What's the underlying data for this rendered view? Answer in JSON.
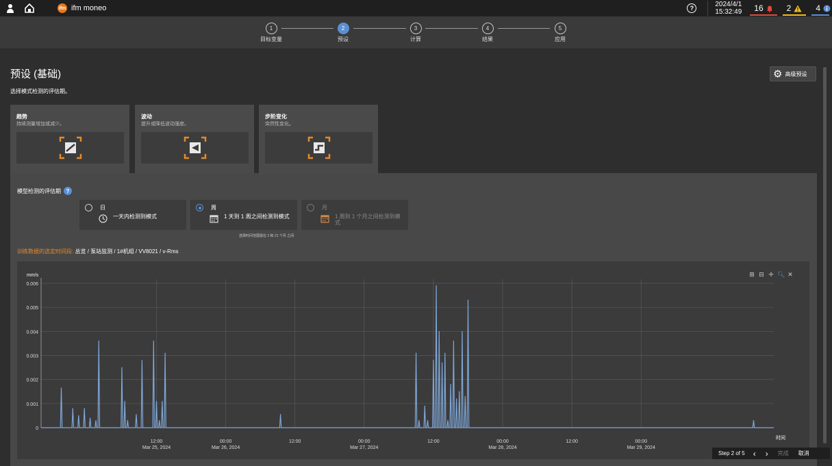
{
  "topbar": {
    "app_title": "ifm moneo",
    "date": "2024/4/1",
    "time": "15:32:49",
    "alarms": [
      {
        "count": "16",
        "icon": "bell-icon",
        "color": "#e04a3a"
      },
      {
        "count": "2",
        "icon": "warning-icon",
        "color": "#f0c020"
      },
      {
        "count": "4",
        "icon": "info-icon",
        "color": "#5b8fd4"
      }
    ]
  },
  "wizard": {
    "steps": [
      {
        "num": "1",
        "label": "目标变量"
      },
      {
        "num": "2",
        "label": "预设"
      },
      {
        "num": "3",
        "label": "计算"
      },
      {
        "num": "4",
        "label": "结果"
      },
      {
        "num": "5",
        "label": "应用"
      }
    ],
    "active_step": 2
  },
  "page": {
    "title": "预设 (基础)",
    "subtitle": "选择模式检测的评估期。",
    "advanced_button": "高级预设"
  },
  "cards": [
    {
      "title": "趋势",
      "desc": "持续测量增加或减少。",
      "icon": "trend-icon"
    },
    {
      "title": "波动",
      "desc": "提升或降低波动强度。",
      "icon": "fluctuation-icon"
    },
    {
      "title": "步阶变化",
      "desc": "突然性变化。",
      "icon": "step-change-icon"
    }
  ],
  "period": {
    "label": "模型检测的评估期",
    "options": [
      {
        "name": "日",
        "desc": "一天内检测到模式",
        "icon": "clock-icon",
        "selected": false,
        "enabled": true
      },
      {
        "name": "周",
        "desc": "1 天到 1 周之间检测到模式",
        "icon": "calendar-icon",
        "selected": true,
        "enabled": true
      },
      {
        "name": "月",
        "desc": "1 周到 1 个月之间检测到模式",
        "icon": "calendar-icon",
        "selected": false,
        "enabled": false
      }
    ],
    "note": "选择时间范围需在 2 和 21 个月 之间"
  },
  "training": {
    "prefix": "训练数据的选定时间段:",
    "path": "总览 / 泵站监测 / 1#机组 / VV8021 / v-Rms"
  },
  "chart_data": {
    "type": "line",
    "ylabel": "mm/s",
    "xlabel": "时间",
    "ylim": [
      0,
      0.006
    ],
    "yticks": [
      "0",
      "0.001",
      "0.002",
      "0.003",
      "0.004",
      "0.005",
      "0.006"
    ],
    "xlim": [
      "2024-03-24 16:00",
      "2024-03-29 23:00"
    ],
    "xticks": [
      {
        "time": "12:00",
        "date": "Mar 25, 2024"
      },
      {
        "time": "00:00",
        "date": "Mar 26, 2024"
      },
      {
        "time": "12:00",
        "date": ""
      },
      {
        "time": "00:00",
        "date": "Mar 27, 2024"
      },
      {
        "time": "12:00",
        "date": ""
      },
      {
        "time": "00:00",
        "date": "Mar 28, 2024"
      },
      {
        "time": "12:00",
        "date": ""
      },
      {
        "time": "00:00",
        "date": "Mar 29, 2024"
      }
    ],
    "series": [
      {
        "color": "#7fa7d8",
        "spikes": [
          [
            "2024-03-24 19:30",
            0.00165
          ],
          [
            "2024-03-24 21:30",
            0.0008
          ],
          [
            "2024-03-24 22:30",
            0.0005
          ],
          [
            "2024-03-24 23:30",
            0.0008
          ],
          [
            "2024-03-25 00:30",
            0.0004
          ],
          [
            "2024-03-25 01:30",
            0.0003
          ],
          [
            "2024-03-25 02:00",
            0.0036
          ],
          [
            "2024-03-25 06:00",
            0.0025
          ],
          [
            "2024-03-25 06:30",
            0.0011
          ],
          [
            "2024-03-25 07:00",
            0.0003
          ],
          [
            "2024-03-25 08:30",
            0.00055
          ],
          [
            "2024-03-25 09:30",
            0.0028
          ],
          [
            "2024-03-25 11:30",
            0.0036
          ],
          [
            "2024-03-25 12:00",
            0.0011
          ],
          [
            "2024-03-25 12:30",
            0.0003
          ],
          [
            "2024-03-25 13:00",
            0.0011
          ],
          [
            "2024-03-25 13:30",
            0.0031
          ],
          [
            "2024-03-26 09:30",
            0.00055
          ],
          [
            "2024-03-27 09:00",
            0.0031
          ],
          [
            "2024-03-27 09:30",
            0.0003
          ],
          [
            "2024-03-27 10:30",
            0.0009
          ],
          [
            "2024-03-27 11:00",
            0.0003
          ],
          [
            "2024-03-27 12:00",
            0.0028
          ],
          [
            "2024-03-27 12:30",
            0.0059
          ],
          [
            "2024-03-27 13:00",
            0.004
          ],
          [
            "2024-03-27 13:30",
            0.0027
          ],
          [
            "2024-03-27 14:00",
            0.0031
          ],
          [
            "2024-03-27 14:30",
            0.0003
          ],
          [
            "2024-03-27 15:00",
            0.0018
          ],
          [
            "2024-03-27 15:30",
            0.0036
          ],
          [
            "2024-03-27 16:00",
            0.0012
          ],
          [
            "2024-03-27 16:30",
            0.0015
          ],
          [
            "2024-03-27 17:00",
            0.004
          ],
          [
            "2024-03-27 17:30",
            0.0013
          ],
          [
            "2024-03-27 18:00",
            0.0053
          ],
          [
            "2024-03-29 19:30",
            0.0003
          ]
        ]
      }
    ],
    "grid": true
  },
  "chart_toolbar": [
    "zoom-in-icon",
    "zoom-out-icon",
    "pan-icon",
    "magnify-icon",
    "reset-icon"
  ],
  "tour": {
    "step": "Step 2 of 5",
    "finish": "完成",
    "cancel": "取消"
  }
}
